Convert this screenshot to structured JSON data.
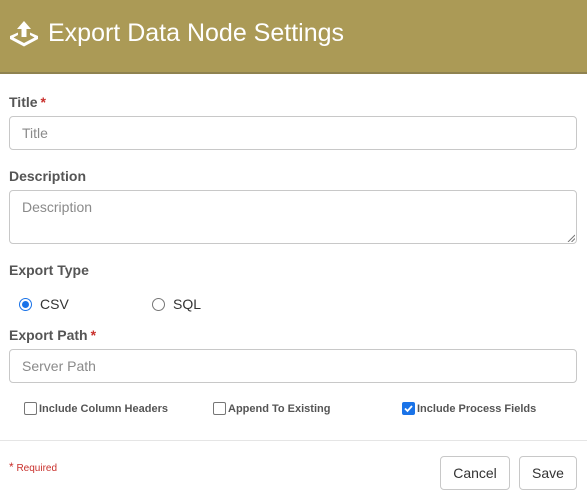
{
  "header": {
    "title": "Export Data Node Settings",
    "bg_color": "#ab9a56",
    "icon": "export-icon"
  },
  "form": {
    "title": {
      "label": "Title",
      "required_mark": "*",
      "placeholder": "Title",
      "value": ""
    },
    "description": {
      "label": "Description",
      "placeholder": "Description",
      "value": ""
    },
    "export_type": {
      "label": "Export Type",
      "options": [
        {
          "label": "CSV",
          "selected": true
        },
        {
          "label": "SQL",
          "selected": false
        }
      ]
    },
    "export_path": {
      "label": "Export Path",
      "required_mark": "*",
      "placeholder": "Server Path",
      "value": ""
    },
    "checkboxes": [
      {
        "label": "Include Column Headers",
        "checked": false
      },
      {
        "label": "Append To Existing",
        "checked": false
      },
      {
        "label": "Include Process Fields",
        "checked": true
      }
    ]
  },
  "footer": {
    "required_star": "*",
    "required_text": "Required",
    "cancel_label": "Cancel",
    "save_label": "Save"
  },
  "colors": {
    "accent": "#1a73e8",
    "required": "#c9302c"
  }
}
